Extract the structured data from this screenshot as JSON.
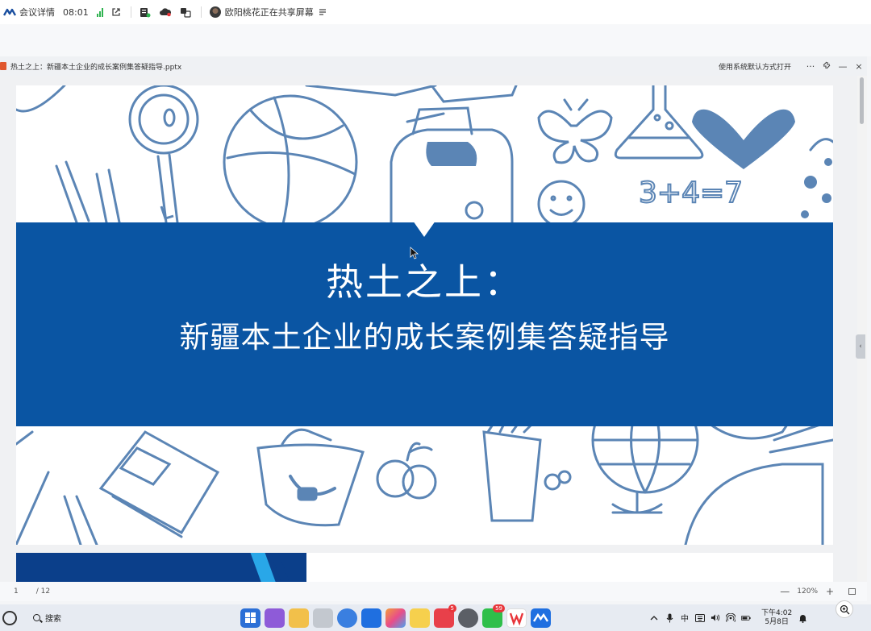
{
  "meeting_bar": {
    "details_label": "会议详情",
    "timer": "08:01",
    "sharing_text": "欧阳桃花正在共享屏幕"
  },
  "document": {
    "title": "热土之上：新疆本土企业的成长案例集答疑指导.pptx",
    "open_default_label": "使用系统默认方式打开",
    "more_label": "···",
    "minimize_label": "—",
    "close_label": "×"
  },
  "slide": {
    "title": "热土之上：",
    "subtitle": "新疆本土企业的成长案例集答疑指导",
    "doodle_text": "3+4=7"
  },
  "status": {
    "current_page": "1",
    "total_pages": "/ 12",
    "zoom": "120%",
    "zoom_out": "—",
    "zoom_in": "+"
  },
  "taskbar": {
    "search_label": "搜索",
    "apps": [
      {
        "name": "start-menu",
        "color": "#2b6fd6"
      },
      {
        "name": "widgets",
        "color": "#8e5bd8"
      },
      {
        "name": "file-explorer",
        "color": "#f2c04a"
      },
      {
        "name": "recycle-bin",
        "color": "#b8bec8"
      },
      {
        "name": "browser",
        "color": "#3a7fe0"
      },
      {
        "name": "mail",
        "color": "#1f6fe0"
      },
      {
        "name": "photos",
        "color": "#f39c3a"
      },
      {
        "name": "sticky-notes",
        "color": "#f6d04d"
      },
      {
        "name": "app-store",
        "color": "#e8404a",
        "badge": "5"
      },
      {
        "name": "settings",
        "color": "#5b5f66"
      },
      {
        "name": "wechat",
        "color": "#2fbf4a",
        "badge": "59"
      },
      {
        "name": "wps-office",
        "color": "#e8353a"
      },
      {
        "name": "tencent-meeting",
        "color": "#1f6fe0"
      }
    ],
    "clock_time": "下午4:02",
    "clock_date": "5月8日",
    "ime_label": "中"
  },
  "colors": {
    "slide_band": "#0a55a3",
    "doodle_stroke": "#5b85b5",
    "signal_green": "#2fb350"
  }
}
